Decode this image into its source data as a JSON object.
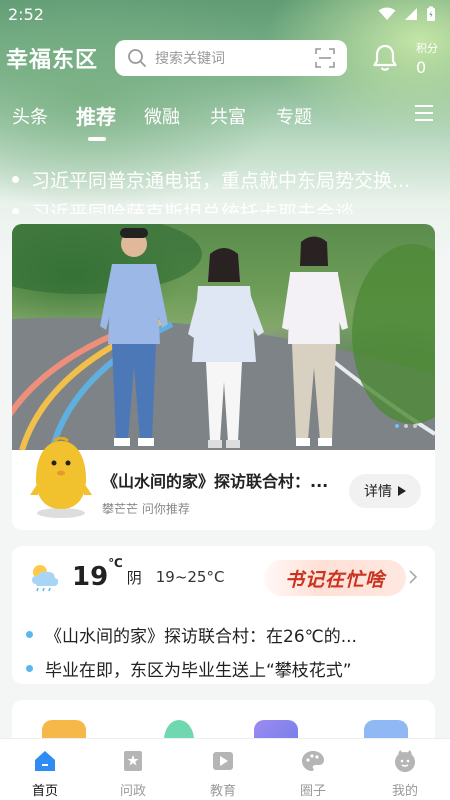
{
  "status": {
    "time": "2:52"
  },
  "header": {
    "title": "幸福东区",
    "search_placeholder": "搜索关键词",
    "points_label": "积分",
    "points_value": "0"
  },
  "tabs": [
    {
      "label": "头条",
      "active": false
    },
    {
      "label": "推荐",
      "active": true
    },
    {
      "label": "微融",
      "active": false
    },
    {
      "label": "共富",
      "active": false
    },
    {
      "label": "专题",
      "active": false
    }
  ],
  "ticker": [
    "习近平同普京通电话，重点就中东局势交换...",
    "习近平同哈萨克斯坦总统托卡耶夫会谈"
  ],
  "hero": {
    "title": "《山水间的家》探访联合村：...",
    "subtitle": "攀芒芒 问你推荐",
    "detail_label": "详情"
  },
  "weather": {
    "temp": "19",
    "unit": "℃",
    "condition": "阴",
    "range": "19~25°C",
    "banner": "书记在忙啥",
    "news": [
      "《山水间的家》探访联合村：在26℃的...",
      "毕业在即，东区为毕业生送上“攀枝花式”"
    ]
  },
  "bottom_nav": [
    {
      "label": "首页",
      "icon": "home-icon",
      "active": true
    },
    {
      "label": "问政",
      "icon": "bookmark-star-icon",
      "active": false
    },
    {
      "label": "教育",
      "icon": "play-icon",
      "active": false
    },
    {
      "label": "圈子",
      "icon": "palette-icon",
      "active": false
    },
    {
      "label": "我的",
      "icon": "profile-icon",
      "active": false
    }
  ],
  "colors": {
    "accent_blue": "#2f8cf5",
    "banner_red": "#c9331f",
    "news_dot": "#5bb6ee"
  }
}
